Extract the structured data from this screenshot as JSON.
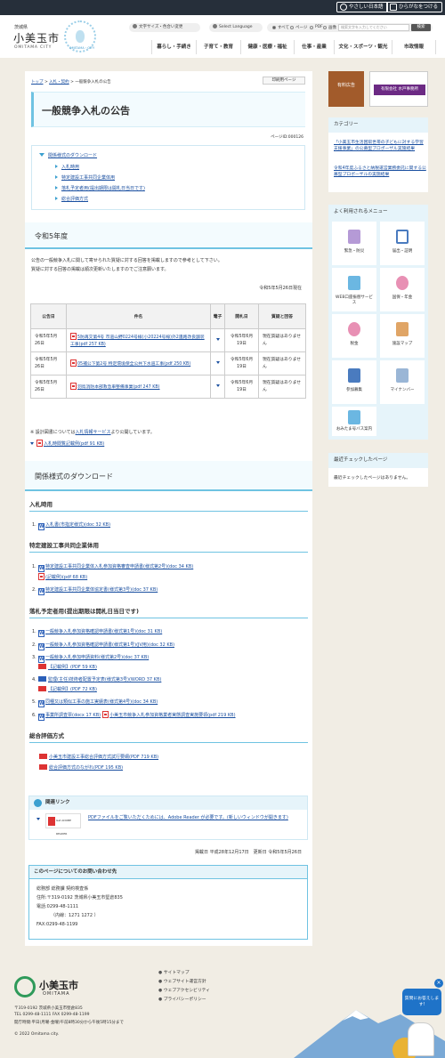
{
  "topbar": {
    "easy_jp": "やさしい日本語",
    "furigana": "ひらがなをつける"
  },
  "header": {
    "pref": "茨城県",
    "city": "小美玉市",
    "city_en": "OMITAMA CITY",
    "mascot_text": "OMITAMA・CITY",
    "text_size": "文字サイズ・色合い変更",
    "language": "Select Language",
    "radios": [
      "すべて",
      "ページ",
      "PDF",
      "画像"
    ],
    "search_placeholder": "検索文字を入力してください",
    "search_btn": "検索"
  },
  "gnav": [
    "暮らし・手続き",
    "子育て・教育",
    "健康・医療・福祉",
    "仕事・産業",
    "文化・スポーツ・観光",
    "市政情報"
  ],
  "breadcrumb": {
    "home": "トップ",
    "mid": "入札・契約",
    "sep": ">",
    "current": "一般競争入札の公告"
  },
  "print": "印刷用ページ",
  "title": "一般競争入札の公告",
  "page_id": "ページID:000126",
  "toc": {
    "head": "関係様式のダウンロード",
    "items": [
      "入札時用",
      "特定建設工事共同企業体用",
      "落札予定者用(提出期限は開札日当日です)",
      "総合評価方式"
    ]
  },
  "section1": {
    "title": "令和5年度",
    "p1": "公告の一般競争入札に関して寄せられた質疑に対する回答を掲載しますので参考として下さい。",
    "p2": "質疑に対する回答の掲載は順次更新いたしますのでご注意願います。",
    "date": "令和5年5月26日現在"
  },
  "table": {
    "headers": [
      "公告日",
      "件名",
      "電子",
      "開札日",
      "質疑と回答"
    ],
    "rows": [
      {
        "date": "令和5年5月26日",
        "name": "5防再交第4号 市道山野0224号線(小20224号線)外2遺路改良舗装工事(pdf 257 KB)",
        "open": "令和5年6月19日",
        "qa": "現在質疑はありません"
      },
      {
        "date": "令和5年5月26日",
        "name": "05補公下第2号 特定環境保全公共下水道工事(pdf 250 KB)",
        "open": "令和5年6月19日",
        "qa": "現在質疑はありません"
      },
      {
        "date": "令和5年5月26日",
        "name": "羽鳥消防本部救急車整備事業(pdf 247 KB)",
        "open": "令和5年6月19日",
        "qa": "現在質疑はありません"
      }
    ]
  },
  "notes": {
    "n1a": "※ 設計図書については",
    "n1link": "入札情報サービス",
    "n1b": "より公開しています。",
    "n2": "入札時閲覧記載例(pdf 91 KB)"
  },
  "download": {
    "title": "関係様式のダウンロード",
    "g1": {
      "title": "入札時用",
      "items": [
        "入札書(市指定様式)(doc 32 KB)"
      ]
    },
    "g2": {
      "title": "特定建設工事共同企業体用",
      "items": [
        "特定建設工事共同企業体入札参加資格審査申請書(様式第2号)(doc 34 KB)",
        "(記載例)(pdf 68 KB)",
        "特定建設工事共同企業体協定書(様式第3号)(doc 37 KB)"
      ]
    },
    "g3": {
      "title": "落札予定者用(提出期限は開札日当日です)",
      "items": [
        "一般競争入札参加資格確認申請書(様式第1号)(doc 31 KB)",
        "一般競争入札参加資格確認申請書(様式第1号)(JV用)(doc 32 KB)",
        "一般競争入札参加申請資料(様式第2号)(doc 37 KB)",
        "【記載例】(PDF 59 KB)",
        "監理(主任)技術者配置予定表(様式第3号)(WORD 37 KB)",
        "【記載例】(PDF 72 KB)",
        "同種又は類似工事の施工実績表(様式第4号)(doc 34 KB)",
        "事業所調査票(docx 17 KB)",
        "小美玉市競争入札参加資格業者実態調査実施要領(pdf 219 KB)"
      ]
    },
    "g4": {
      "title": "総合評価方式",
      "items": [
        "小美玉市建設工事総合評価方式試行要綱(PDF 719 KB)",
        "総合評価方式のながれ(PDF 195 KB)"
      ]
    }
  },
  "related": {
    "title": "関連リンク",
    "text": "PDFファイルをご覧いただくためには、Adobe Reader が必要です。(新しいウィンドウが開きます)",
    "badge": "Get ADOBE READER"
  },
  "dates": "掲載日 平成28年12月17日　更新日 令和5年5月26日",
  "contact": {
    "title": "このページについてのお問い合わせ先",
    "lines": [
      "総務部 総務課 契約検査係",
      "住所:〒319-0192 茨城県小美玉市堅倉835",
      "電話:0299-48-1111",
      "（内線：1271 1272 ）",
      "FAX:0299-48-1199"
    ]
  },
  "side": {
    "ad1": "有料広告",
    "ad2": "有限会社 水戸事務所",
    "cat_title": "カテゴリー",
    "cats": [
      "「小美玉市生活困窮世帯の子どもに対する学習支援事業」の公募型プロポーザル実施結果",
      "令和4年度ふるさと納税運営業務委託に関する公募型プロポーザルの実施結果"
    ],
    "menu_title": "よく利用されるメニュー",
    "menu": [
      "緊急・防災",
      "届出・証明",
      "WEB口座振替サービス",
      "国保・年金",
      "税金",
      "施設マップ",
      "参加募集",
      "マイナンバー",
      "おみたま号バス案内"
    ],
    "recent_title": "最近チェックしたページ",
    "recent_text": "最近チェックしたページはありません。"
  },
  "footer": {
    "name": "小美玉市",
    "en": "OMITAMA",
    "addr": "〒319-0192 茨城県小美玉市堅倉835",
    "tel": "TEL 0299-48-1111  FAX 0299-48-1199",
    "hours": "開庁時間:平日(月曜-金曜)午前8時30分から午後5時15分まで",
    "copy": "© 2022 Omitama city.",
    "links": [
      "サイトマップ",
      "ウェブサイト運営方針",
      "ウェブアクセシビリティ",
      "プライバシーポリシー"
    ],
    "bubble": "質問にお答えします!"
  }
}
